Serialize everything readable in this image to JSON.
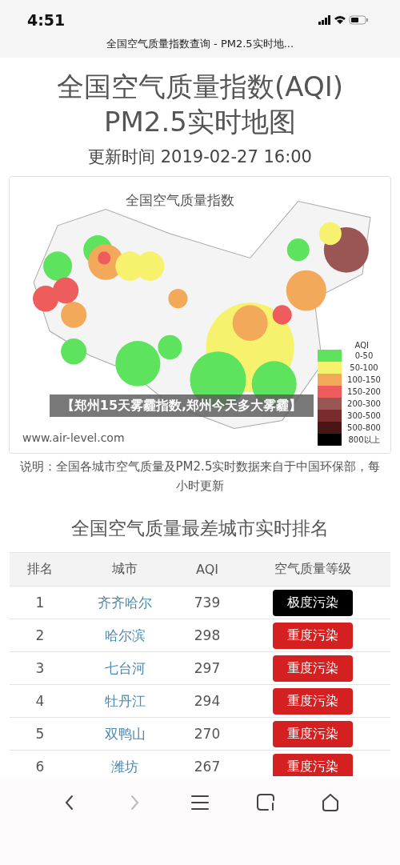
{
  "status_bar": {
    "time": "4:51"
  },
  "browser": {
    "title": "全国空气质量指数查询 - PM2.5实时地..."
  },
  "page": {
    "title_lines": [
      "全国空气质量指数(AQI)",
      "PM2.5实时地图"
    ],
    "updated": "更新时间 2019-02-27 16:00"
  },
  "map": {
    "title": "全国空气质量指数",
    "source": "www.air-level.com",
    "legend_title": "AQI",
    "legend": [
      {
        "label": "0-50",
        "color": "#5ee35e"
      },
      {
        "label": "50-100",
        "color": "#f7f26e"
      },
      {
        "label": "100-150",
        "color": "#f2a95a"
      },
      {
        "label": "150-200",
        "color": "#ee5c5c"
      },
      {
        "label": "200-300",
        "color": "#9a5555"
      },
      {
        "label": "300-500",
        "color": "#7a2c2c"
      },
      {
        "label": "500-800",
        "color": "#4a1515"
      },
      {
        "label": "800以上",
        "color": "#000000"
      }
    ]
  },
  "caption": "【郑州15天雾霾指数,郑州今天多大雾霾】",
  "note": "说明：全国各城市空气质量及PM2.5实时数据来自于中国环保部，每小时更新",
  "ranking": {
    "title": "全国空气质量最差城市实时排名",
    "columns": [
      "排名",
      "城市",
      "AQI",
      "空气质量等级"
    ],
    "rows": [
      {
        "rank": "1",
        "city": "齐齐哈尔",
        "aqi": "739",
        "grade": {
          "text": "极度污染",
          "color": "#000000"
        }
      },
      {
        "rank": "2",
        "city": "哈尔滨",
        "aqi": "298",
        "grade": {
          "text": "重度污染",
          "color": "#d42020"
        }
      },
      {
        "rank": "3",
        "city": "七台河",
        "aqi": "297",
        "grade": {
          "text": "重度污染",
          "color": "#d42020"
        }
      },
      {
        "rank": "4",
        "city": "牡丹江",
        "aqi": "294",
        "grade": {
          "text": "重度污染",
          "color": "#d42020"
        }
      },
      {
        "rank": "5",
        "city": "双鸭山",
        "aqi": "270",
        "grade": {
          "text": "重度污染",
          "color": "#d42020"
        }
      },
      {
        "rank": "6",
        "city": "潍坊",
        "aqi": "267",
        "grade": {
          "text": "重度污染",
          "color": "#d42020"
        }
      }
    ]
  },
  "toolbar": [
    {
      "kind": "back",
      "disabled": false
    },
    {
      "kind": "forward",
      "disabled": true
    },
    {
      "kind": "menu",
      "disabled": false
    },
    {
      "kind": "tabs",
      "disabled": false
    },
    {
      "kind": "home",
      "disabled": false
    }
  ]
}
